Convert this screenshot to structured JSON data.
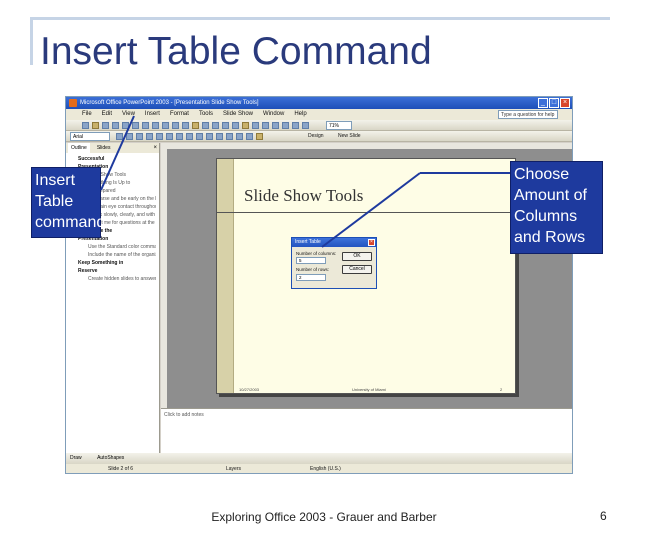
{
  "slide": {
    "title": "Insert Table Command",
    "footer": "Exploring Office 2003 - Grauer and Barber",
    "page_number": "6"
  },
  "callouts": {
    "left": "Insert Table command",
    "right": "Choose Amount of Columns and Rows"
  },
  "app": {
    "window_title": "Microsoft Office PowerPoint 2003 - [Presentation Slide Show Tools]",
    "menu": [
      "File",
      "Edit",
      "View",
      "Insert",
      "Format",
      "Tools",
      "Slide Show",
      "Window",
      "Help"
    ],
    "help_placeholder": "Type a question for help",
    "font_name": "Arial",
    "zoom": "71%",
    "design_label": "Design",
    "new_slide_label": "New Slide",
    "pane_tabs": [
      "Outline",
      "Slides"
    ],
    "outline": [
      {
        "num": "3",
        "text": "Successful",
        "head": true
      },
      {
        "text": "Presentation",
        "head": true
      },
      {
        "text": "Slide Show Tools"
      },
      {
        "text": "Everything Is Up to"
      },
      {
        "text": "Be prepared"
      },
      {
        "text": "Rehearse and be early on the big day"
      },
      {
        "text": "Maintain eye contact throughout presentation"
      },
      {
        "text": "Speak slowly, clearly, and with sufficient volume for the audience"
      },
      {
        "text": "Allow time for questions at the end"
      },
      {
        "num": "4",
        "text": "Customize the",
        "head": true
      },
      {
        "text": "Presentation",
        "head": true
      },
      {
        "text": "Use the Standard color command in the view menu to add common elements to each slide"
      },
      {
        "text": "Include the name of the organization, date of the presentation, and/or an appropriate logo"
      },
      {
        "num": "5",
        "text": "Keep Something in",
        "head": true
      },
      {
        "text": "Reserve",
        "head": true
      },
      {
        "text": "Create hidden slides to answer difficult questions that might occur"
      }
    ],
    "slide_heading": "Slide Show Tools",
    "slide_footer_left": "10/27/2003",
    "slide_footer_center": "University of Miami",
    "slide_footer_right": "2",
    "notes_placeholder": "Click to add notes",
    "draw_label": "Draw",
    "autoshapes_label": "AutoShapes",
    "status": {
      "slide": "Slide 2 of 6",
      "design": "Layers",
      "language": "English (U.S.)"
    }
  },
  "dialog": {
    "title": "Insert Table",
    "columns_label": "Number of columns:",
    "columns_value": "5",
    "rows_label": "Number of rows:",
    "rows_value": "2",
    "ok": "OK",
    "cancel": "Cancel"
  },
  "colors": {
    "callout_bg": "#1e3a9e",
    "title_color": "#2a3a7c"
  }
}
